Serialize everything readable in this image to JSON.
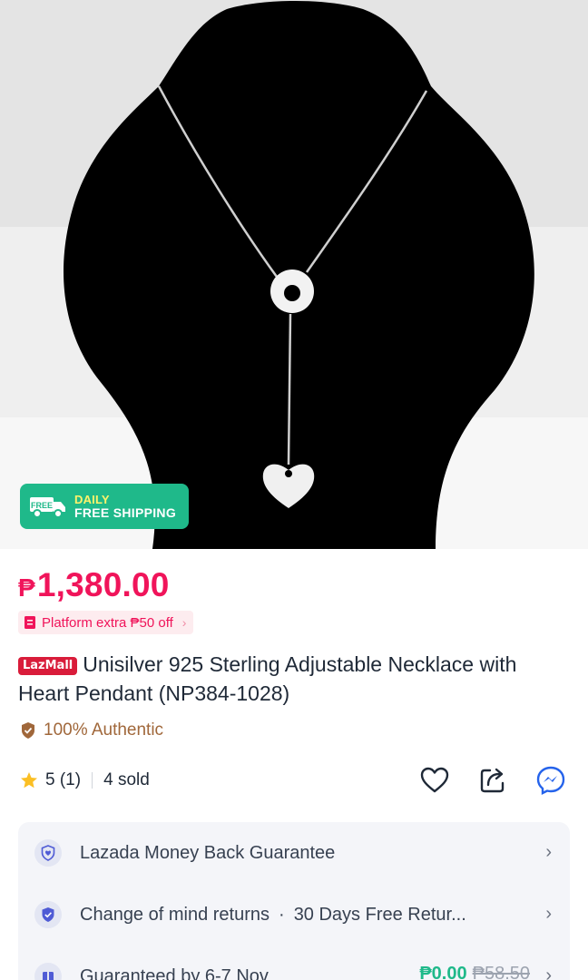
{
  "shipping_badge": {
    "icon_label": "FREE",
    "line1": "DAILY",
    "line2": "FREE SHIPPING",
    "color": "#1fb98a"
  },
  "price": {
    "currency": "₱",
    "amount": "1,380.00",
    "color": "#f0145a"
  },
  "voucher": {
    "label": "Platform extra ₱50 off",
    "chevron": "›"
  },
  "product": {
    "badge": "LazMall",
    "title": "Unisilver 925 Sterling Adjustable Necklace with Heart Pendant (NP384-1028)"
  },
  "authentic": {
    "label": "100% Authentic"
  },
  "rating": {
    "score": "5",
    "count": "(1)",
    "sold": "4 sold"
  },
  "actions": [
    "heart-icon",
    "share-icon",
    "messenger-icon"
  ],
  "services": [
    {
      "icon": "shield-heart-icon",
      "label": "Lazada Money Back Guarantee"
    },
    {
      "icon": "shield-check-icon",
      "label": "Change of mind returns",
      "extra": "30 Days Free Retur...",
      "separator": "·"
    },
    {
      "icon": "package-icon",
      "label": "Guaranteed by 6-7 Nov",
      "price_free": "₱0.00",
      "price_original": "₱58.50"
    }
  ],
  "chevron": "›"
}
